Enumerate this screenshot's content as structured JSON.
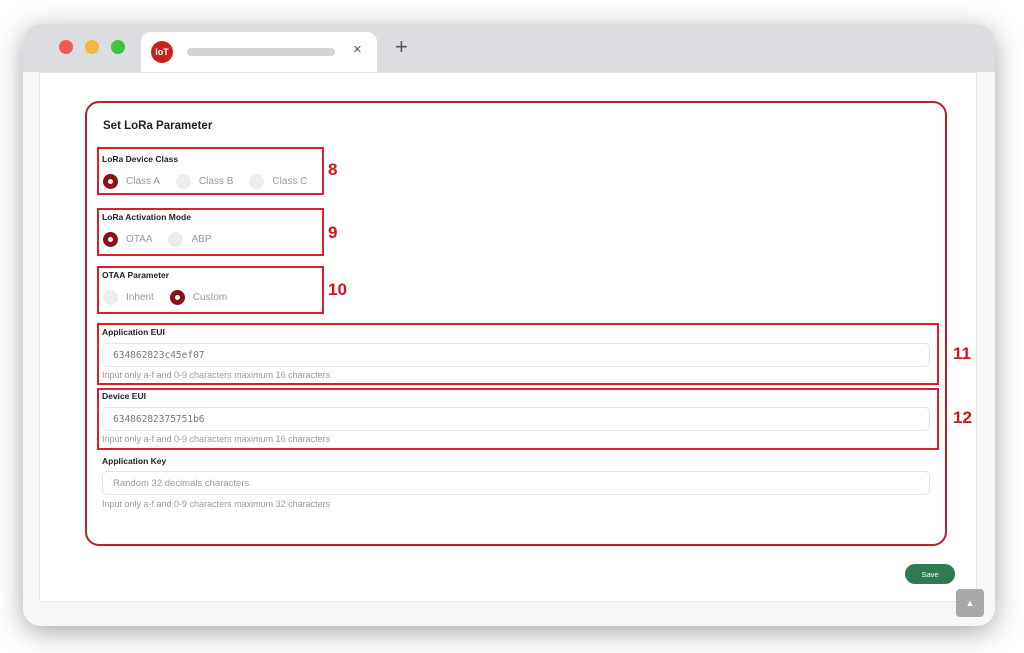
{
  "browser": {
    "favicon_text": "IoT",
    "close_glyph": "×",
    "newtab_glyph": "+"
  },
  "form": {
    "section_title": "Set LoRa Parameter",
    "device_class": {
      "label": "LoRa Device Class",
      "options": [
        "Class A",
        "Class B",
        "Class C"
      ],
      "selected": "Class A"
    },
    "activation_mode": {
      "label": "LoRa Activation Mode",
      "options": [
        "OTAA",
        "ABP"
      ],
      "selected": "OTAA"
    },
    "otaa_parameter": {
      "label": "OTAA Parameter",
      "options": [
        "Inherit",
        "Custom"
      ],
      "selected": "Custom"
    },
    "app_eui": {
      "label": "Application EUI",
      "value": "634862823c45ef07",
      "hint": "Input only a-f and 0-9 characters maximum 16 characters"
    },
    "dev_eui": {
      "label": "Device EUI",
      "value": "63486282375751b6",
      "hint": "Input only a-f and 0-9 characters maximum 16 characters"
    },
    "app_key": {
      "label": "Application Key",
      "placeholder": "Random 32 decimals characters",
      "hint": "Input only a-f and 0-9 characters maximum 32 characters"
    },
    "save_label": "Save"
  },
  "annotations": {
    "n8": "8",
    "n9": "9",
    "n10": "10",
    "n11": "11",
    "n12": "12",
    "color": "#dd1f2c"
  },
  "scroll_top_glyph": "▲",
  "colors": {
    "accent": "#8e1017",
    "save": "#2f7a52",
    "section_border": "#b8222c"
  }
}
